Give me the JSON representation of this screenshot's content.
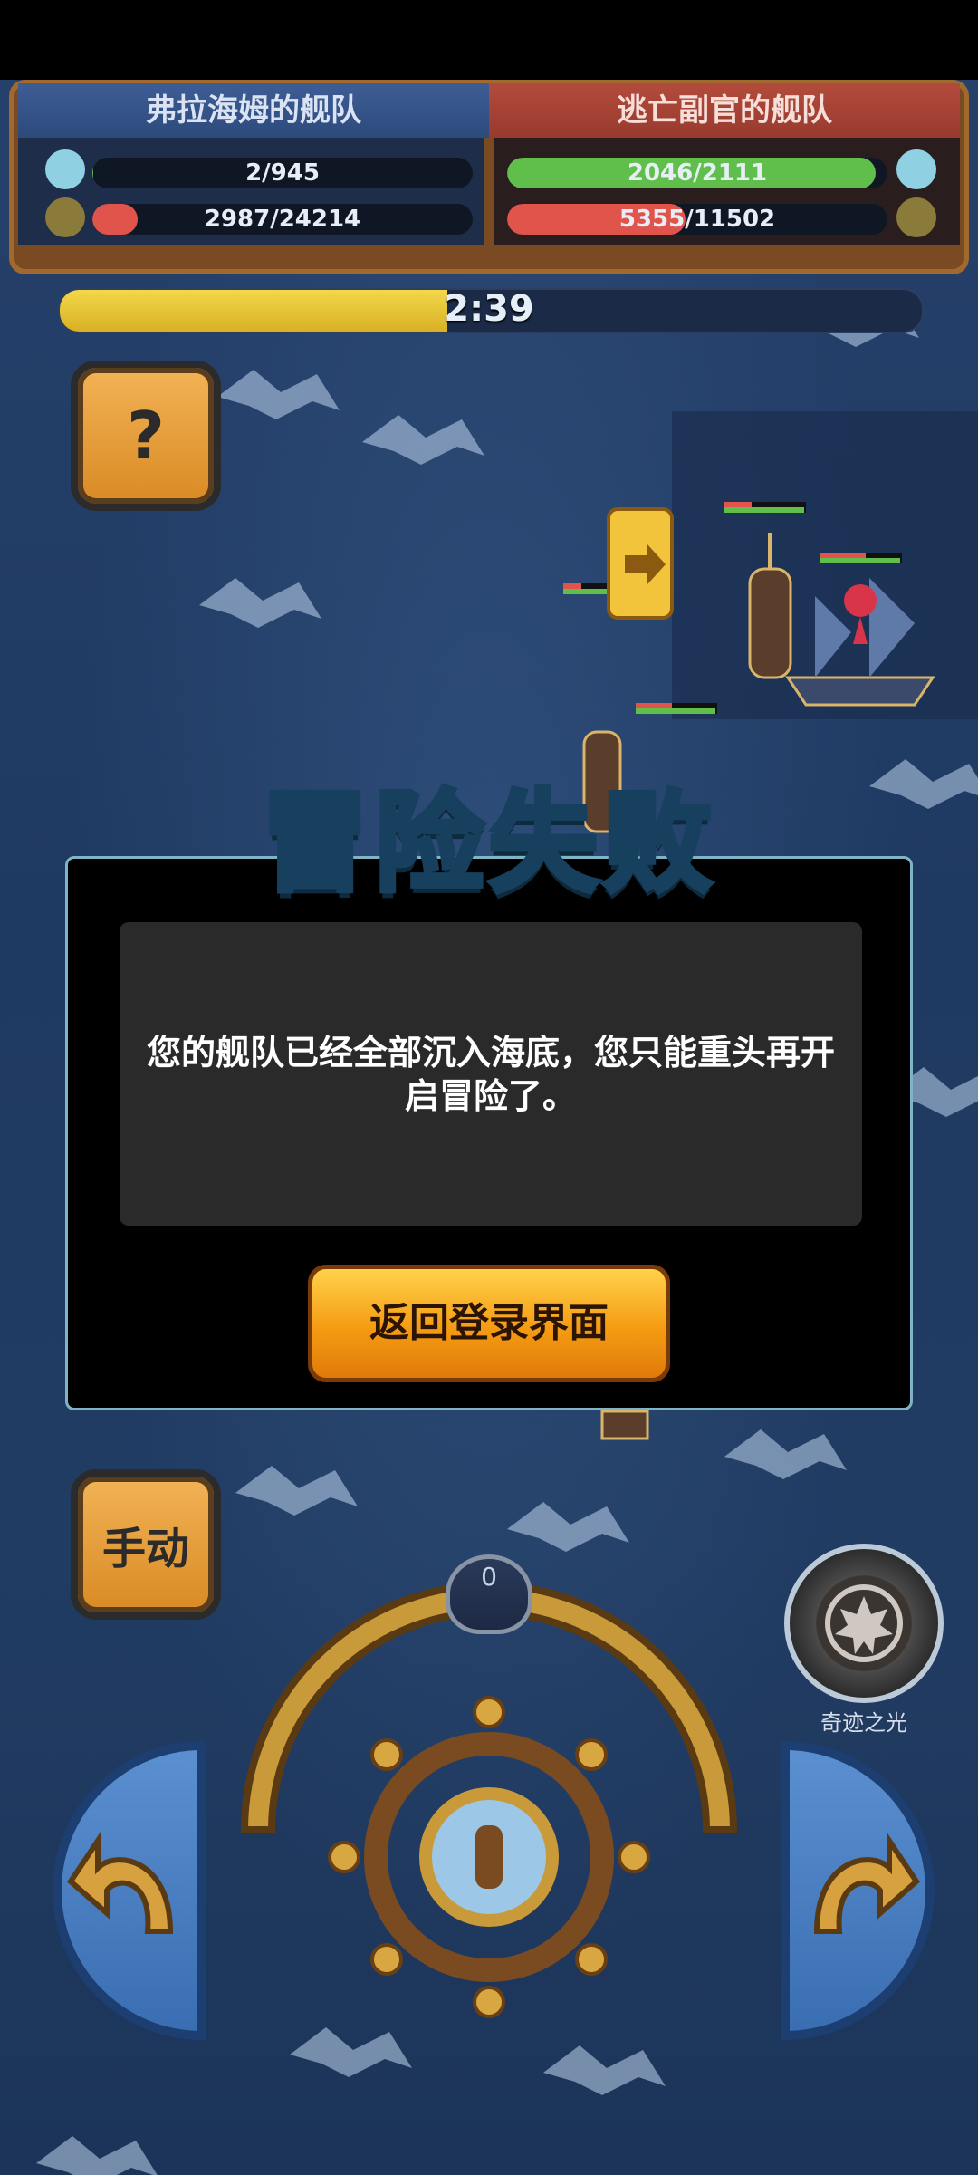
{
  "hud": {
    "left_fleet_name": "弗拉海姆的舰队",
    "right_fleet_name": "逃亡副官的舰队",
    "left_crew": "2/945",
    "left_hull": "2987/24214",
    "right_crew": "2046/2111",
    "right_hull": "5355/11502",
    "left_crew_fraction": 0.002,
    "left_hull_fraction": 0.12,
    "right_crew_fraction": 0.97,
    "right_hull_fraction": 0.47
  },
  "timer": {
    "text": "2:39",
    "fraction": 0.45
  },
  "help_button": "?",
  "manual_button": "手动",
  "dialog": {
    "title": "冒险失败",
    "message": "您的舰队已经全部沉入海底，您只能重头再开启冒险了。",
    "return_button": "返回登录界面"
  },
  "gauge_value": "0",
  "miracle_label": "奇迹之光",
  "colors": {
    "hp_red": "#e0544b",
    "crew_green": "#5fbf4a",
    "timer_yellow": "#e9c43a",
    "button_orange": "#f59b12"
  }
}
